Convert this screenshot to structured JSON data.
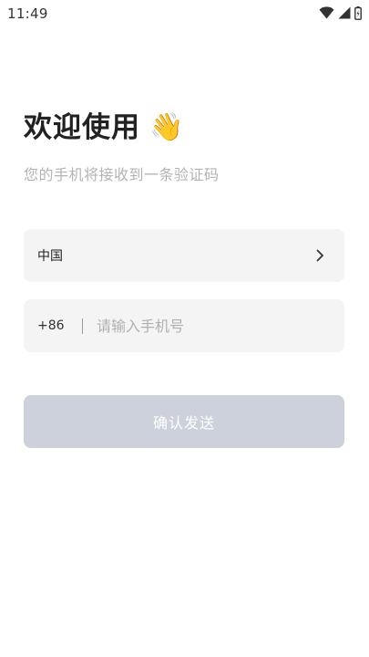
{
  "status_bar": {
    "time": "11:49",
    "icons": [
      "wifi-icon",
      "cellular-signal-icon",
      "battery-icon"
    ]
  },
  "header": {
    "title": "欢迎使用",
    "emoji": "👋",
    "subtitle": "您的手机将接收到一条验证码"
  },
  "form": {
    "country": {
      "label": "中国",
      "icon": "chevron-right-icon"
    },
    "phone": {
      "dial_code": "+86",
      "value": "",
      "placeholder": "请输入手机号"
    },
    "submit_label": "确认发送"
  },
  "colors": {
    "field_background": "#f4f4f5",
    "button_disabled": "#cdd1dc",
    "title_text": "#222222",
    "hint_text": "#b3b3b3"
  }
}
